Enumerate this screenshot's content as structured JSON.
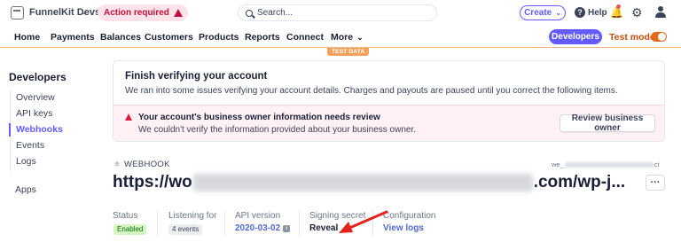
{
  "topbar": {
    "account_name": "FunnelKit Devs",
    "action_required": "Action required",
    "search_placeholder": "Search...",
    "create_label": "Create",
    "help_label": "Help"
  },
  "nav": {
    "items": [
      "Home",
      "Payments",
      "Balances",
      "Customers",
      "Products",
      "Reports",
      "Connect",
      "More"
    ],
    "developers_label": "Developers",
    "test_mode_label": "Test mode",
    "test_mode_on": true,
    "test_data_label": "TEST DATA"
  },
  "sidebar": {
    "title": "Developers",
    "items": [
      "Overview",
      "API keys",
      "Webhooks",
      "Events",
      "Logs"
    ],
    "active": "Webhooks",
    "apps_label": "Apps"
  },
  "verify_card": {
    "title": "Finish verifying your account",
    "description": "We ran into some issues verifying your account details. Charges and payouts are paused until you correct the following items.",
    "alert_title": "Your account's business owner information needs review",
    "alert_desc": "We couldn't verify the information provided about your business owner.",
    "review_button": "Review business owner"
  },
  "webhook": {
    "section_label": "WEBHOOK",
    "id_prefix": "we_",
    "id_suffix": "ct",
    "url_start": "https://wo",
    "url_end": ".com/wp-j...",
    "more_label": "···"
  },
  "properties": {
    "status_label": "Status",
    "status_value": "Enabled",
    "listening_label": "Listening for",
    "listening_value": "4 events",
    "api_label": "API version",
    "api_value": "2020-03-02",
    "secret_label": "Signing secret",
    "secret_value": "Reveal",
    "config_label": "Configuration",
    "config_value": "View logs"
  },
  "colors": {
    "accent": "#635bff",
    "test_mode": "#e5691d",
    "danger": "#df1b41",
    "annotation_arrow": "#e3231b"
  }
}
